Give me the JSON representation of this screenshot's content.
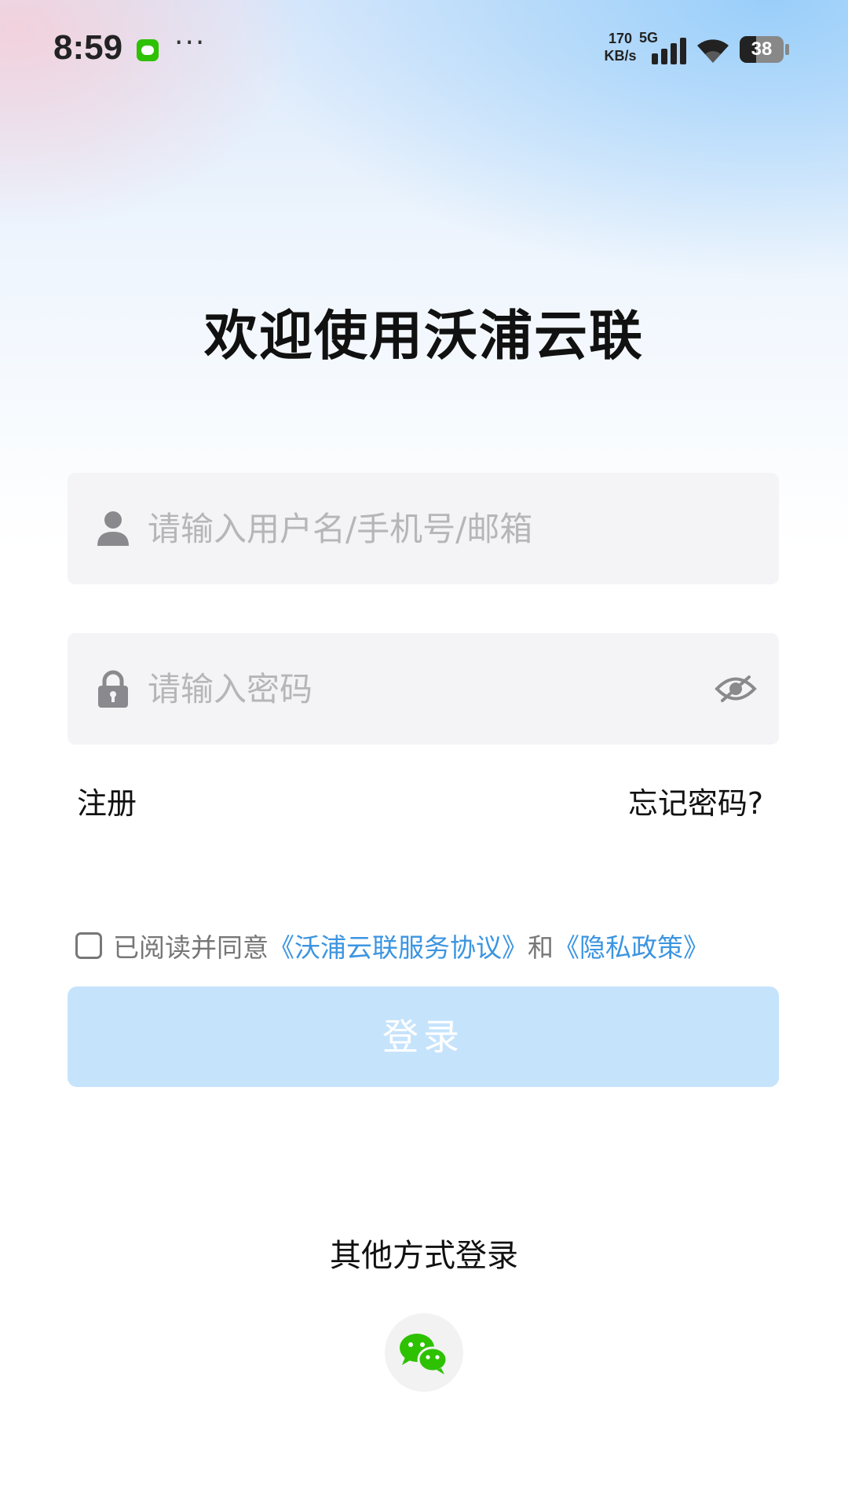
{
  "status_bar": {
    "time": "8:59",
    "net_speed_value": "170",
    "net_speed_unit": "KB/s",
    "network": "5G",
    "battery": "38",
    "more_dots": "···"
  },
  "title": "欢迎使用沃浦云联",
  "username_field": {
    "placeholder": "请输入用户名/手机号/邮箱",
    "value": ""
  },
  "password_field": {
    "placeholder": "请输入密码",
    "value": ""
  },
  "register_link": "注册",
  "forgot_link": "忘记密码?",
  "agreement": {
    "prefix": "已阅读并同意",
    "service_link": "《沃浦云联服务协议》",
    "and": "和",
    "privacy_link": "《隐私政策》",
    "checked": false
  },
  "login_button": "登录",
  "other_login_label": "其他方式登录",
  "icons": {
    "user": "user-icon",
    "lock": "lock-icon",
    "eye": "eye-off-icon",
    "wechat": "wechat-icon"
  },
  "colors": {
    "accent": "#3c95e0",
    "login_disabled": "#c6e3fc",
    "wechat_green": "#2dc100"
  }
}
